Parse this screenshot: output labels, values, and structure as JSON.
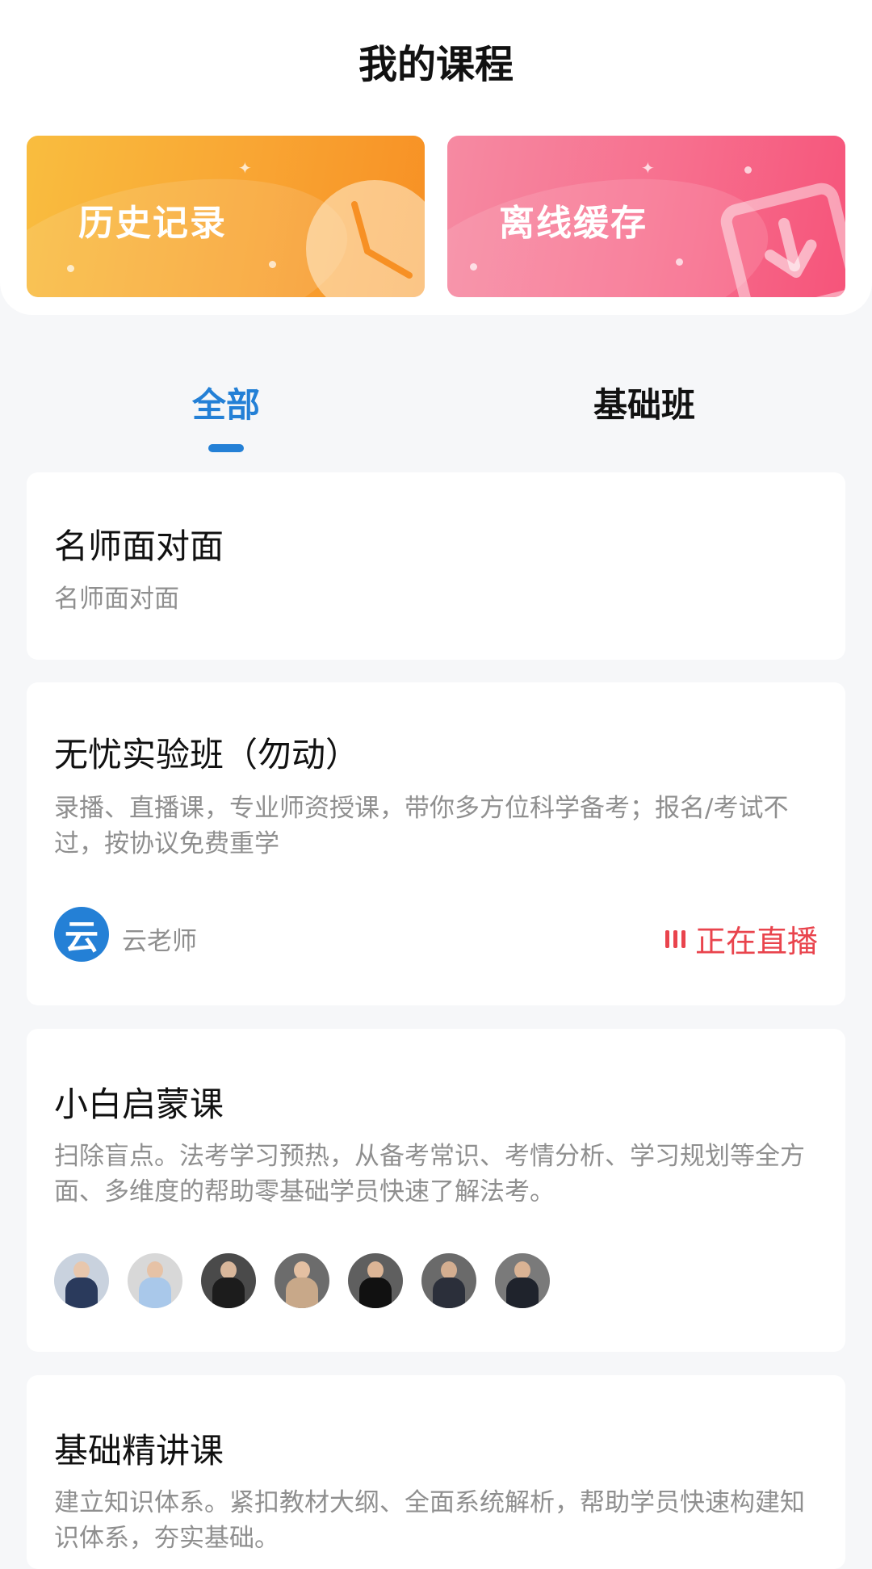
{
  "header": {
    "title": "我的课程"
  },
  "quick_actions": [
    {
      "label": "历史记录",
      "icon": "clock-icon"
    },
    {
      "label": "离线缓存",
      "icon": "download-icon"
    }
  ],
  "tabs": [
    {
      "label": "全部",
      "active": true
    },
    {
      "label": "基础班",
      "active": false
    }
  ],
  "courses": [
    {
      "title": "名师面对面",
      "desc": "名师面对面"
    },
    {
      "title": "无忧实验班（勿动）",
      "desc": "录播、直播课，专业师资授课，带你多方位科学备考；报名/考试不过，按协议免费重学",
      "teacher": {
        "avatar_char": "云",
        "name": "云老师"
      },
      "status": "正在直播"
    },
    {
      "title": "小白启蒙课",
      "desc": "扫除盲点。法考学习预热，从备考常识、考情分析、学习规划等全方面、多维度的帮助零基础学员快速了解法考。",
      "teacher_avatar_count": 7
    },
    {
      "title": "基础精讲课",
      "desc": "建立知识体系。紧扣教材大纲、全面系统解析，帮助学员快速构建知识体系，夯实基础。"
    }
  ],
  "colors": {
    "accent": "#2480d6",
    "live": "#e9444d",
    "history_card": "#f9a533",
    "offline_card": "#f76f8e"
  }
}
